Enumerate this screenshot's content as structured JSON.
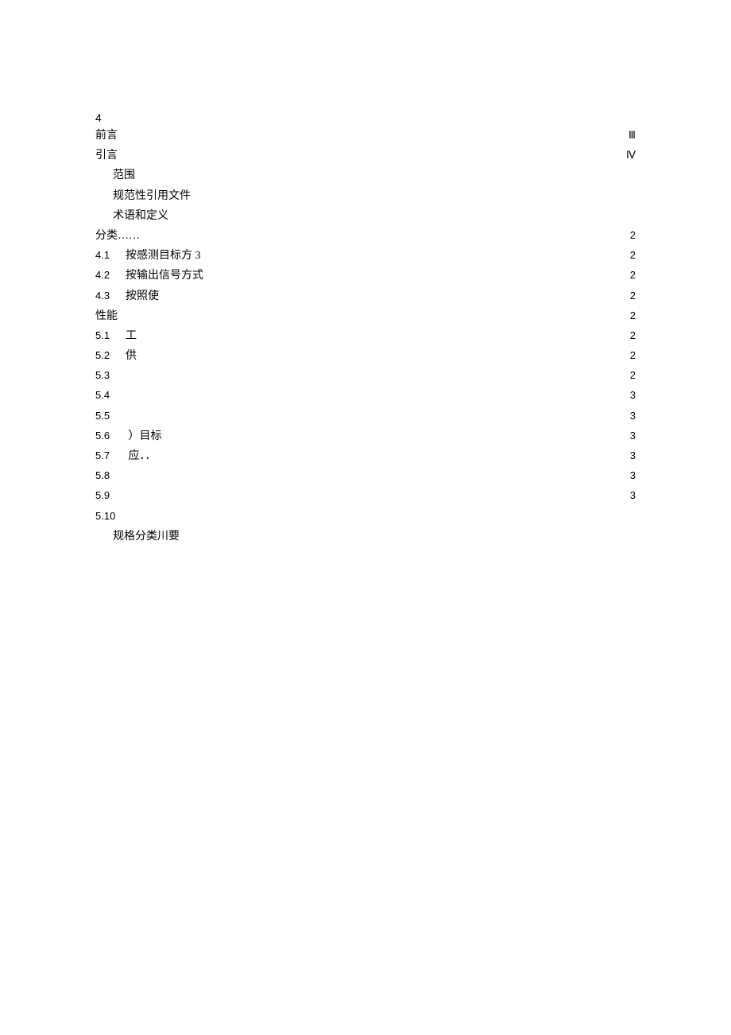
{
  "page_marker": "4",
  "lines": [
    {
      "indent": 0,
      "num": "",
      "label": "前言",
      "page": "Ⅲ"
    },
    {
      "indent": 0,
      "num": "",
      "label": "引言",
      "page": "Ⅳ"
    },
    {
      "indent": 1,
      "num": "",
      "label": "范围",
      "page": ""
    },
    {
      "indent": 1,
      "num": "",
      "label": "规范性引用文件",
      "page": ""
    },
    {
      "indent": 1,
      "num": "",
      "label": "术语和定义",
      "page": ""
    },
    {
      "indent": 0,
      "num": "",
      "label": "分类……",
      "page": "2"
    },
    {
      "indent": 0,
      "num": "4.1",
      "label": "按感测目标方 3",
      "page": "2"
    },
    {
      "indent": 0,
      "num": "4.2",
      "label": "按输出信号方式",
      "page": "2"
    },
    {
      "indent": 0,
      "num": "4.3",
      "label": "按照使",
      "page": "2"
    },
    {
      "indent": 0,
      "num": "",
      "label": "性能",
      "page": "2"
    },
    {
      "indent": 0,
      "num": "5.1",
      "label": "工",
      "page": "2"
    },
    {
      "indent": 0,
      "num": "5.2",
      "label": "供",
      "page": "2"
    },
    {
      "indent": 0,
      "num": "5.3",
      "label": "",
      "page": "2"
    },
    {
      "indent": 0,
      "num": "5.4",
      "label": "",
      "page": "3"
    },
    {
      "indent": 0,
      "num": "5.5",
      "label": "",
      "page": "3"
    },
    {
      "indent": 0,
      "num": "5.6",
      "label": "            ）目标",
      "page": "3"
    },
    {
      "indent": 0,
      "num": "5.7",
      "label": "               应．．",
      "page": "3"
    },
    {
      "indent": 0,
      "num": "5.8",
      "label": "",
      "page": "3"
    },
    {
      "indent": 0,
      "num": "5.9",
      "label": "",
      "page": "3"
    },
    {
      "indent": 0,
      "num": "5.10",
      "label": "",
      "page": ""
    },
    {
      "indent": 1,
      "num": "",
      "label": "规格分类川要",
      "page": ""
    }
  ]
}
